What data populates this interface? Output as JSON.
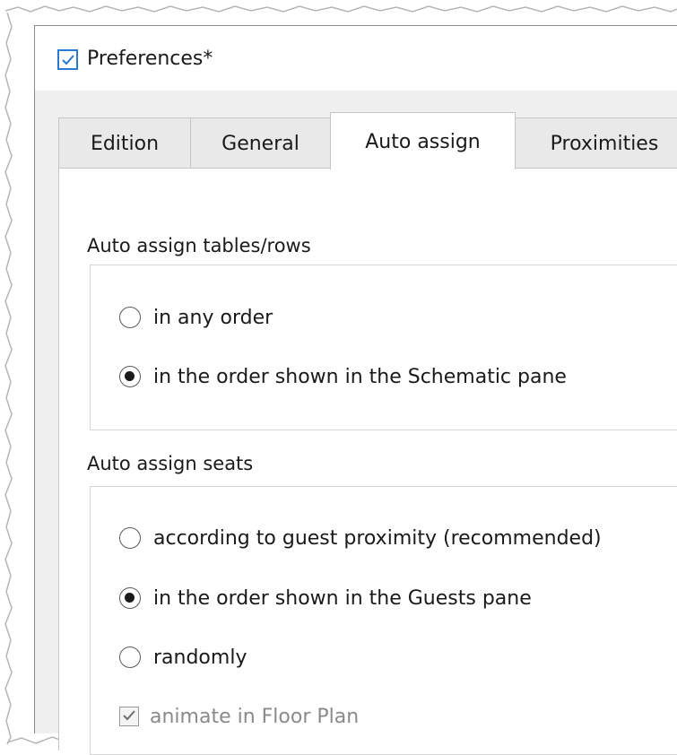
{
  "window": {
    "title": "Preferences*",
    "icon": "checkbox-check-icon"
  },
  "tabs": [
    {
      "label": "Edition",
      "active": false
    },
    {
      "label": "General",
      "active": false
    },
    {
      "label": "Auto assign",
      "active": true
    },
    {
      "label": "Proximities",
      "active": false
    }
  ],
  "auto_assign_tables": {
    "label": "Auto assign tables/rows",
    "options": [
      {
        "label": "in any order",
        "checked": false
      },
      {
        "label": "in the order shown in the Schematic pane",
        "checked": true
      }
    ]
  },
  "auto_assign_seats": {
    "label": "Auto assign seats",
    "options": [
      {
        "label": "according to guest proximity (recommended)",
        "checked": false
      },
      {
        "label": "in the order shown in the Guests pane",
        "checked": true
      },
      {
        "label": "randomly",
        "checked": false
      }
    ],
    "animate": {
      "label": "animate in Floor Plan",
      "checked": true,
      "enabled": false
    }
  },
  "colors": {
    "accent": "#2b79d0",
    "window_bg": "#f0f0f0",
    "panel_bg": "#ffffff"
  }
}
